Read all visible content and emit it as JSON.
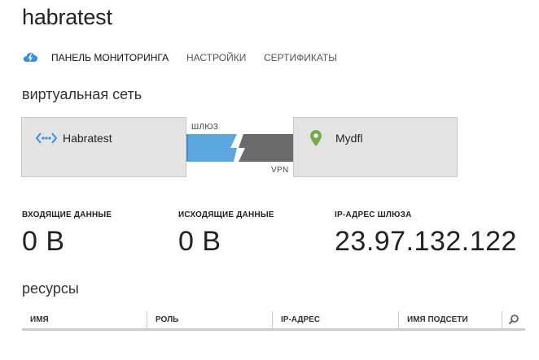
{
  "header": {
    "title": "habratest"
  },
  "tabs": [
    {
      "label": "ПАНЕЛЬ МОНИТОРИНГА",
      "active": true
    },
    {
      "label": "НАСТРОЙКИ",
      "active": false
    },
    {
      "label": "СЕРТИФИКАТЫ",
      "active": false
    }
  ],
  "network": {
    "section_title": "виртуальная сеть",
    "local": {
      "name": "Habratest",
      "icon": "network-icon"
    },
    "gateway_label": "ШЛЮЗ",
    "vpn_label": "VPN",
    "remote": {
      "name": "Mydfl",
      "icon": "location-pin-icon"
    }
  },
  "stats": [
    {
      "label": "ВХОДЯЩИЕ ДАННЫЕ",
      "value": "0 B"
    },
    {
      "label": "ИСХОДЯЩИЕ ДАННЫЕ",
      "value": "0 B"
    },
    {
      "label": "IP-АДРЕС ШЛЮЗА",
      "value": "23.97.132.122"
    }
  ],
  "resources": {
    "section_title": "ресурсы",
    "columns": [
      "ИМЯ",
      "РОЛЬ",
      "IP-АДРЕС",
      "ИМЯ ПОДСЕТИ"
    ]
  },
  "colors": {
    "accent": "#3a8fd8",
    "gateway_blue": "#5ca7e0",
    "gateway_dark": "#6a6a6a",
    "pin_green": "#7aab4a"
  }
}
